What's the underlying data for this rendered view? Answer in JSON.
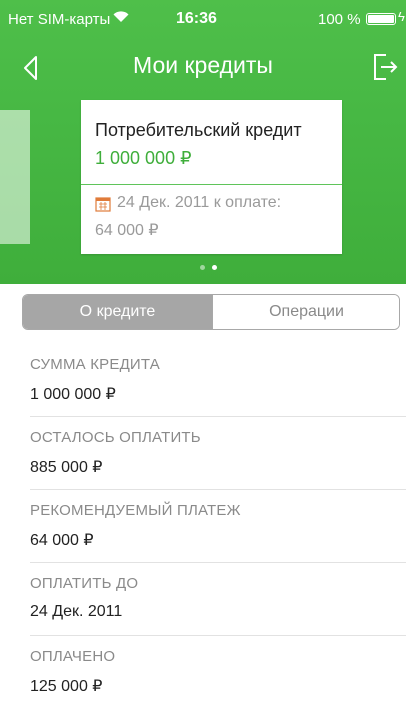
{
  "status_bar": {
    "carrier": "Нет SIM-карты",
    "time": "16:36",
    "battery": "100 %",
    "icons": [
      "wifi-icon",
      "battery-icon",
      "charging-bolt-icon"
    ]
  },
  "nav": {
    "title": "Мои кредиты",
    "back_icon": "chevron-left-icon",
    "logout_icon": "logout-icon"
  },
  "credit_card": {
    "title": "Потребительский кредит",
    "amount": "1 000 000 ₽",
    "date_line": "24 Дек. 2011 к оплате:",
    "payment": "64 000 ₽",
    "icon": "calendar-icon"
  },
  "pager": {
    "pages": 2,
    "current": 2
  },
  "tabs": [
    {
      "label": "О кредите",
      "active": true
    },
    {
      "label": "Операции",
      "active": false
    }
  ],
  "details": [
    {
      "label": "СУММА КРЕДИТА",
      "value": "1 000 000 ₽"
    },
    {
      "label": "ОСТАЛОСЬ ОПЛАТИТЬ",
      "value": "885 000 ₽"
    },
    {
      "label": "РЕКОМЕНДУЕМЫЙ ПЛАТЕЖ",
      "value": "64 000 ₽"
    },
    {
      "label": "ОПЛАТИТЬ ДО",
      "value": "24 Дек. 2011"
    },
    {
      "label": "ОПЛАЧЕНО",
      "value": "125 000 ₽"
    }
  ],
  "colors": {
    "brand_green": "#47b844",
    "amount_green": "#3fae3b",
    "segment_active": "#a6a6a6"
  }
}
